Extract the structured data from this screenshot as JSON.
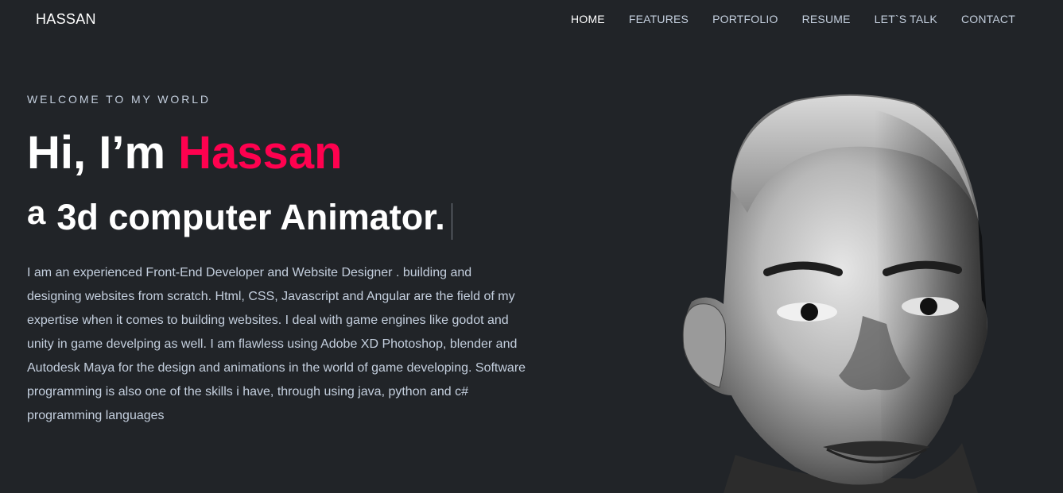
{
  "header": {
    "logo": "HASSAN",
    "nav": [
      {
        "label": "HOME",
        "active": true
      },
      {
        "label": "FEATURES"
      },
      {
        "label": "PORTFOLIO"
      },
      {
        "label": "RESUME"
      },
      {
        "label": "LET`S TALK"
      },
      {
        "label": "CONTACT"
      }
    ]
  },
  "hero": {
    "welcome": "WELCOME TO MY WORLD",
    "greeting": "Hi, I’m ",
    "name": "Hassan",
    "subtitle_article": "a",
    "subtitle_rest": "3d computer Animator.",
    "bio": "I am an experienced Front-End Developer and Website Designer . building and designing websites from scratch. Html, CSS, Javascript and Angular are the field of my expertise when it comes to building websites. I deal with game engines like godot and unity in game develping as well. I am flawless using Adobe XD Photoshop, blender and Autodesk Maya for the design and animations in the world of game developing. Software programming is also one of the skills i have, through using java, python and c# programming languages"
  },
  "colors": {
    "background": "#212428",
    "accent": "#ff014f",
    "body_text": "#c4cfde"
  }
}
